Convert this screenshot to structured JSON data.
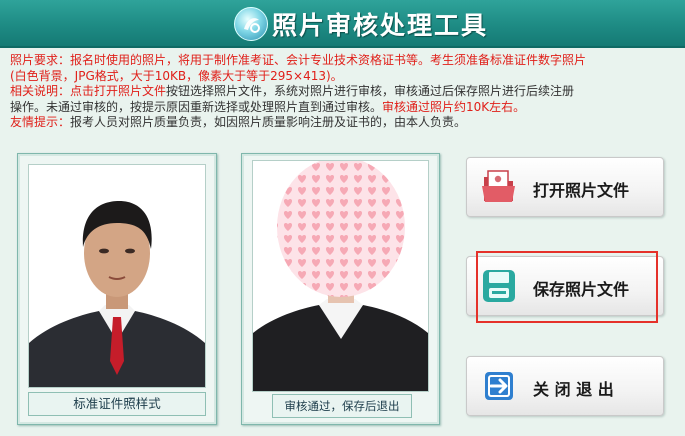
{
  "app": {
    "title": "照片审核处理工具"
  },
  "requirements": {
    "line1_a": "照片要求：报名时使用的照片，将用于制作准考证、会计专业技术资格证书等。考生须准备标准证件数字照片",
    "line2_a": "(白色背景，JPG格式，大于10KB，像素大于等于295×413)。",
    "line3_a": "相关说明：点击",
    "line3_b": "打开照片文件",
    "line3_c": "按钮选择照片文件，系统对照片进行审核，审核通过后保存照片进行后续注册",
    "line4_a": "操作。未通过审核的，按提示原因重新选择或处理照片直到通过审核。",
    "line4_b": "审核通过照片约10K左右。",
    "line5_a": "友情提示：",
    "line5_b": "报考人员对照片质量负责，如因照片质量影响注册及证书的，由本人负责。"
  },
  "sample": {
    "caption": "标准证件照样式"
  },
  "preview": {
    "caption": "审核通过，保存后退出"
  },
  "buttons": {
    "open": "打开照片文件",
    "save": "保存照片文件",
    "exit": "关 闭 退 出"
  },
  "colors": {
    "header": "#1e8b84",
    "highlight": "#e5312a",
    "note_red": "#e0201a"
  },
  "icons": {
    "open": "open-photo-icon",
    "save": "save-icon",
    "exit": "exit-icon"
  }
}
